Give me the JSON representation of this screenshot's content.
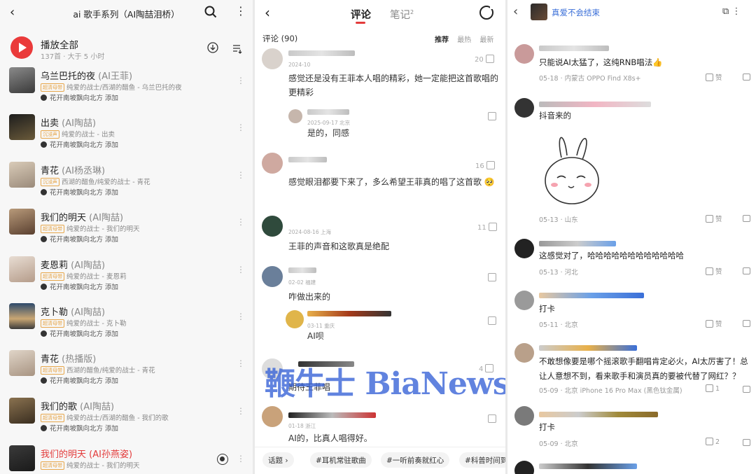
{
  "playlist_panel": {
    "title": "ai 歌手系列（AI陶喆泪桥）",
    "play_all": "播放全部",
    "meta": "137首 · 大于 5 小时",
    "songs": [
      {
        "title": "乌兰巴托的夜",
        "tag": "(AI王菲)",
        "badge": "超清母带",
        "sub": "纯爱的战士/西湖的醋鱼 - 乌兰巴托的夜",
        "added": "花开南坡飘向北方 添加"
      },
      {
        "title": "出卖",
        "tag": "(AI陶喆)",
        "badge": "沉浸声",
        "sub": "纯爱的战士 - 出卖",
        "added": "花开南坡飘向北方 添加"
      },
      {
        "title": "青花",
        "tag": "(AI杨丞琳)",
        "badge": "沉浸声",
        "sub": "西湖的醋鱼/纯爱的战士 - 青花",
        "added": "花开南坡飘向北方 添加"
      },
      {
        "title": "我们的明天",
        "tag": "(AI陶喆)",
        "badge": "超清母带",
        "sub": "纯爱的战士 - 我们的明天",
        "added": "花开南坡飘向北方 添加"
      },
      {
        "title": "麦恩莉",
        "tag": "(AI陶喆)",
        "badge": "超清母带",
        "sub": "纯爱的战士 - 麦恩莉",
        "added": "花开南坡飘向北方 添加"
      },
      {
        "title": "克卜勒",
        "tag": "(AI陶喆)",
        "badge": "超清母带",
        "sub": "纯爱的战士 - 克卜勒",
        "added": "花开南坡飘向北方 添加"
      },
      {
        "title": "青花",
        "tag": "(热播版)",
        "badge": "超清母带",
        "sub": "西湖的醋鱼/纯爱的战士 - 青花",
        "added": "花开南坡飘向北方 添加"
      },
      {
        "title": "我们的歌",
        "tag": "(AI陶喆)",
        "badge": "超清母带",
        "sub": "纯爱的战士/西湖的醋鱼 - 我们的歌",
        "added": "花开南坡飘向北方 添加"
      },
      {
        "title": "我们的明天",
        "tag": "(AI孙燕姿)",
        "badge": "超清母带",
        "sub": "纯爱的战士 - 我们的明天",
        "added": ""
      }
    ]
  },
  "comments_panel": {
    "tab_comments": "评论",
    "tab_notes": "笔记",
    "tab_notes_count": "2",
    "count_label": "评论 (90)",
    "sort_options": [
      "推荐",
      "最热",
      "最新"
    ],
    "comments": [
      {
        "date": "2024-10",
        "text": "感觉还是没有王菲本人唱的精彩，她一定能把这首歌唱的更精彩",
        "likes": "20"
      },
      {
        "date": "2025-09-17 北京",
        "text": "是的，同感",
        "likes": ""
      },
      {
        "date": "",
        "text": "感觉眼泪都要下来了，多么希望王菲真的唱了这首歌 🥺",
        "likes": "16"
      },
      {
        "date": "2024-08-16 上海",
        "text": "王菲的声音和这歌真是绝配",
        "likes": "11"
      },
      {
        "date": "02-02 福建",
        "text": "咋做出来的",
        "likes": ""
      },
      {
        "date": "03-11 重庆",
        "text": "AI呗",
        "likes": ""
      },
      {
        "date": "",
        "text": "期待王菲唱",
        "likes": "4"
      },
      {
        "date": "01-18 浙江",
        "text": "AI的，比真人唱得好。",
        "likes": ""
      }
    ],
    "topics": [
      "话题",
      "#耳机常驻歌曲",
      "#一听前奏就红心",
      "#科普时间到"
    ],
    "watermark": "鞭牛士 BiaNews"
  },
  "replies_panel": {
    "title": "真爱不会结束",
    "replies": [
      {
        "text": "只能说AI太猛了，这纯RNB唱法👍",
        "meta": "05-18 · 内蒙古   OPPO Find X8s+",
        "likes": "赞"
      },
      {
        "text": "抖音来的",
        "meta": "05-13 · 山东",
        "likes": "赞"
      },
      {
        "text": "这感觉对了，哈哈哈哈哈哈哈哈哈哈哈哈",
        "meta": "05-13 · 河北",
        "likes": "赞"
      },
      {
        "text": "打卡",
        "meta": "05-11 · 北京",
        "likes": "赞"
      },
      {
        "text": "不敢想像要是哪个摇滚歌手翻唱肯定必火，AI太厉害了！总让人意想不到，看来歌手和演员真的要被代替了网红？？",
        "meta": "05-09 · 北京   iPhone 16 Pro Max (黑色钛金属)",
        "likes": "1"
      },
      {
        "text": "打卡",
        "meta": "05-09 · 北京",
        "likes": "2"
      }
    ]
  },
  "colors": {
    "accent_red": "#e33b3b",
    "link_blue": "#3b6fd8",
    "badge_orange": "#e7a64a"
  },
  "icons": [
    "back-icon",
    "search-icon",
    "more-icon",
    "play-icon",
    "download-icon",
    "playlist-icon",
    "share-icon",
    "like-icon",
    "message-icon",
    "external-link-icon"
  ]
}
